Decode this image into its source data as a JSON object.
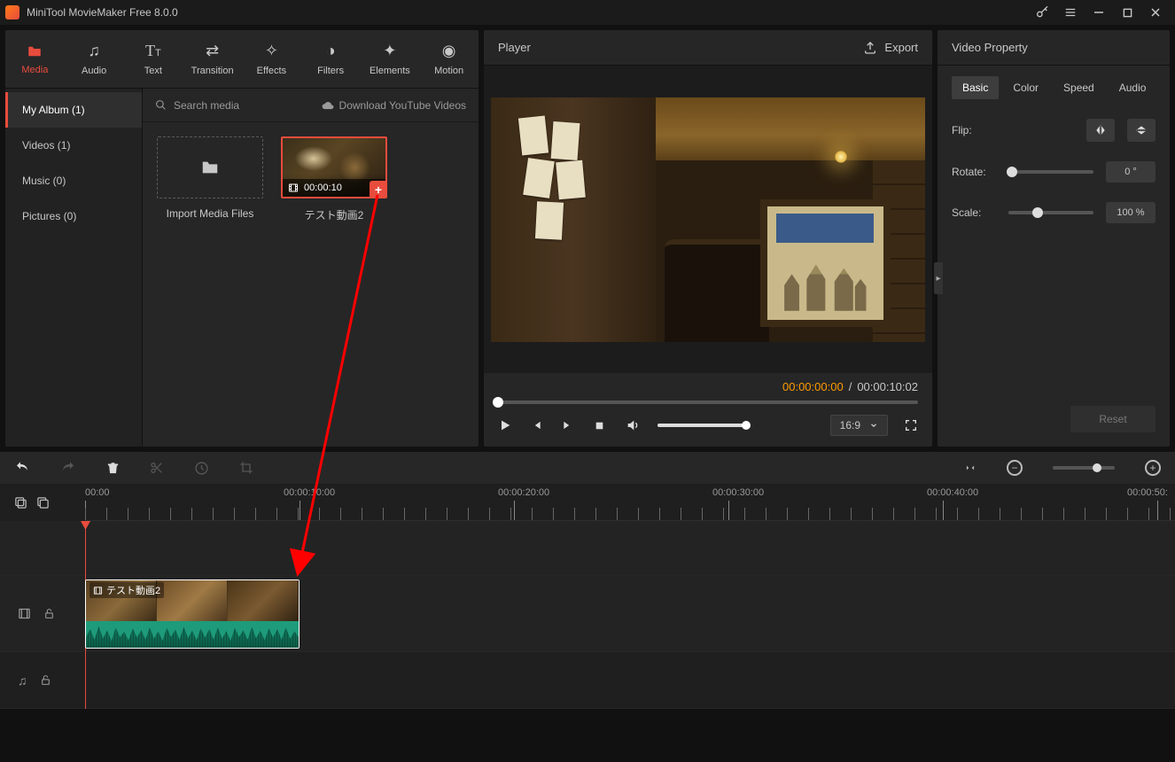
{
  "window": {
    "title": "MiniTool MovieMaker Free 8.0.0"
  },
  "tabs": {
    "media": {
      "label": "Media"
    },
    "audio": {
      "label": "Audio"
    },
    "text": {
      "label": "Text"
    },
    "transition": {
      "label": "Transition"
    },
    "effects": {
      "label": "Effects"
    },
    "filters": {
      "label": "Filters"
    },
    "elements": {
      "label": "Elements"
    },
    "motion": {
      "label": "Motion"
    }
  },
  "sidebar": {
    "items": [
      {
        "label": "My Album (1)"
      },
      {
        "label": "Videos (1)"
      },
      {
        "label": "Music (0)"
      },
      {
        "label": "Pictures (0)"
      }
    ]
  },
  "media": {
    "search_placeholder": "Search media",
    "yt_link": "Download YouTube Videos",
    "import_label": "Import Media Files",
    "clip_name": "テスト動画2",
    "clip_duration": "00:00:10"
  },
  "player": {
    "title": "Player",
    "export": "Export",
    "time_current": "00:00:00:00",
    "time_sep": "/",
    "time_total": "00:00:10:02",
    "aspect": "16:9"
  },
  "props": {
    "title": "Video Property",
    "tabs": {
      "basic": "Basic",
      "color": "Color",
      "speed": "Speed",
      "audio": "Audio"
    },
    "flip_label": "Flip:",
    "rotate_label": "Rotate:",
    "rotate_value": "0 °",
    "scale_label": "Scale:",
    "scale_value": "100 %",
    "reset": "Reset"
  },
  "timeline": {
    "labels": [
      "00:00",
      "00:00:10:00",
      "00:00:20:00",
      "00:00:30:00",
      "00:00:40:00",
      "00:00:50:"
    ],
    "clip_label": "テスト動画2"
  }
}
